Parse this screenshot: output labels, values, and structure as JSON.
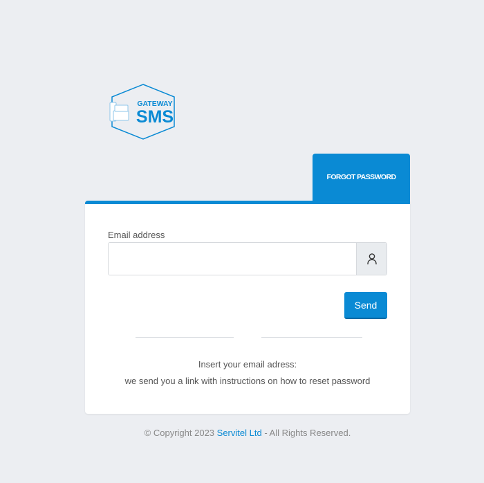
{
  "logo": {
    "line1": "GATEWAY",
    "line2": "SMS",
    "icon": "phone-devices-icon"
  },
  "tab": {
    "label": "FORGOT PASSWORD"
  },
  "form": {
    "email_label": "Email address",
    "email_value": "",
    "email_placeholder": "",
    "user_icon": "user-icon",
    "send_label": "Send"
  },
  "info": {
    "line1": "Insert your email adress:",
    "line2": "we send you a link with instructions on how to reset password"
  },
  "footer": {
    "prefix": "© Copyright 2023 ",
    "company": "Servitel Ltd",
    "suffix": " - All Rights Reserved."
  },
  "colors": {
    "accent": "#0a8ad4",
    "background": "#eceef2",
    "card": "#ffffff"
  }
}
